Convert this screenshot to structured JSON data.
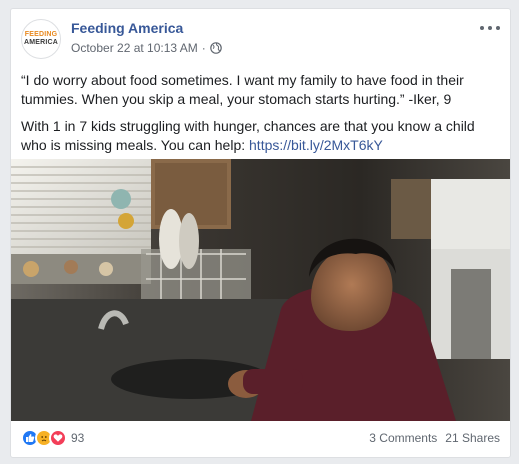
{
  "post": {
    "page_name": "Feeding America",
    "logo": {
      "line1": "FEEDING",
      "line2": "AMERICA"
    },
    "timestamp": "October 22 at 10:13 AM",
    "separator": "·",
    "privacy_icon": "globe-icon",
    "more_icon": "ellipsis-icon",
    "paragraph1": "“I do worry about food sometimes. I want my family to have food in their tummies. When you skip a meal, your stomach starts hurting.” -Iker, 9",
    "paragraph2_text": "With 1 in 7 kids struggling with hunger, chances are that you know a child who is missing meals. You can help: ",
    "paragraph2_link": "https://bit.ly/2MxT6kY"
  },
  "footer": {
    "reaction_icons": [
      "like-icon",
      "sad-icon",
      "love-icon"
    ],
    "reaction_count": "93",
    "comments": "3 Comments",
    "shares": "21 Shares"
  },
  "colors": {
    "link": "#385898",
    "like": "#2078f4",
    "sad": "#f7b125",
    "love": "#f33e58"
  }
}
